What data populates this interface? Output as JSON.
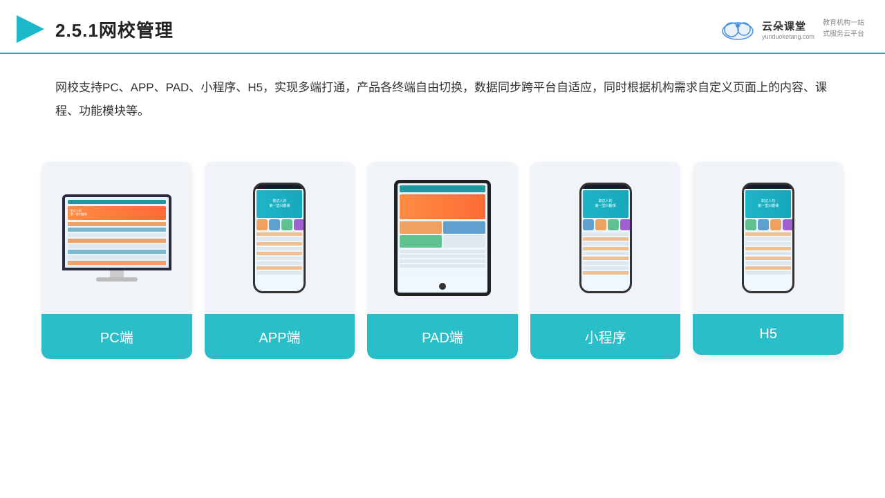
{
  "header": {
    "title": "2.5.1网校管理",
    "logo_name": "云朵课堂",
    "logo_url": "yunduoketang.com",
    "logo_tagline": "教育机构一站\n式服务云平台"
  },
  "description": {
    "text": "网校支持PC、APP、PAD、小程序、H5，实现多端打通，产品各终端自由切换，数据同步跨平台自适应，同时根据机构需求自定义页面上的内容、课程、功能模块等。"
  },
  "cards": [
    {
      "id": "pc",
      "label": "PC端"
    },
    {
      "id": "app",
      "label": "APP端"
    },
    {
      "id": "pad",
      "label": "PAD端"
    },
    {
      "id": "miniapp",
      "label": "小程序"
    },
    {
      "id": "h5",
      "label": "H5"
    }
  ]
}
